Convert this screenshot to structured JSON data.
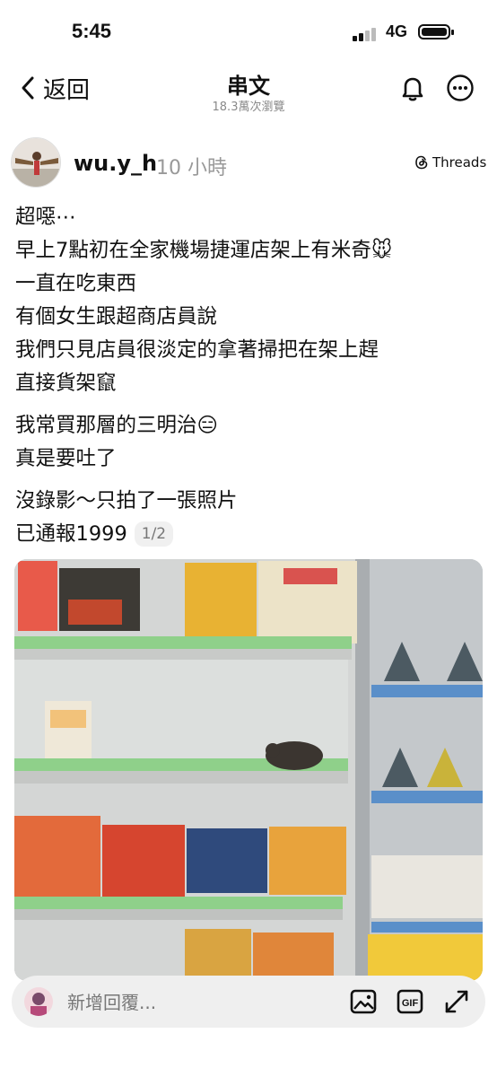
{
  "status_bar": {
    "time": "5:45",
    "network": "4G",
    "battery_level": 1.0
  },
  "nav": {
    "back_label": "返回",
    "title": "串文",
    "subtitle": "18.3萬次瀏覽"
  },
  "post": {
    "username": "wu.y_h",
    "time_ago": "10 小時",
    "app_label": "Threads",
    "lines": [
      "超噁⋯",
      "早上7點初在全家機場捷運店架上有米奇🐭",
      "一直在吃東西",
      "有個女生跟超商店員說",
      "我們只見店員很淡定的拿著掃把在架上趕",
      "直接貨架竄",
      "我常買那層的三明治😑",
      "真是要吐了",
      "沒錄影～只拍了一張照片",
      "已通報1999"
    ],
    "media_counter": "1/2"
  },
  "reply_bar": {
    "placeholder": "新增回覆..."
  },
  "icons": {
    "back": "chevron-left-icon",
    "bell": "bell-icon",
    "more": "more-icon",
    "threads": "threads-logo-icon",
    "image": "image-icon",
    "gif": "gif-icon",
    "expand": "expand-icon"
  },
  "colors": {
    "secondary_text": "#999999",
    "reply_bg": "#efefef",
    "shelf_green": "#8fd08a"
  }
}
